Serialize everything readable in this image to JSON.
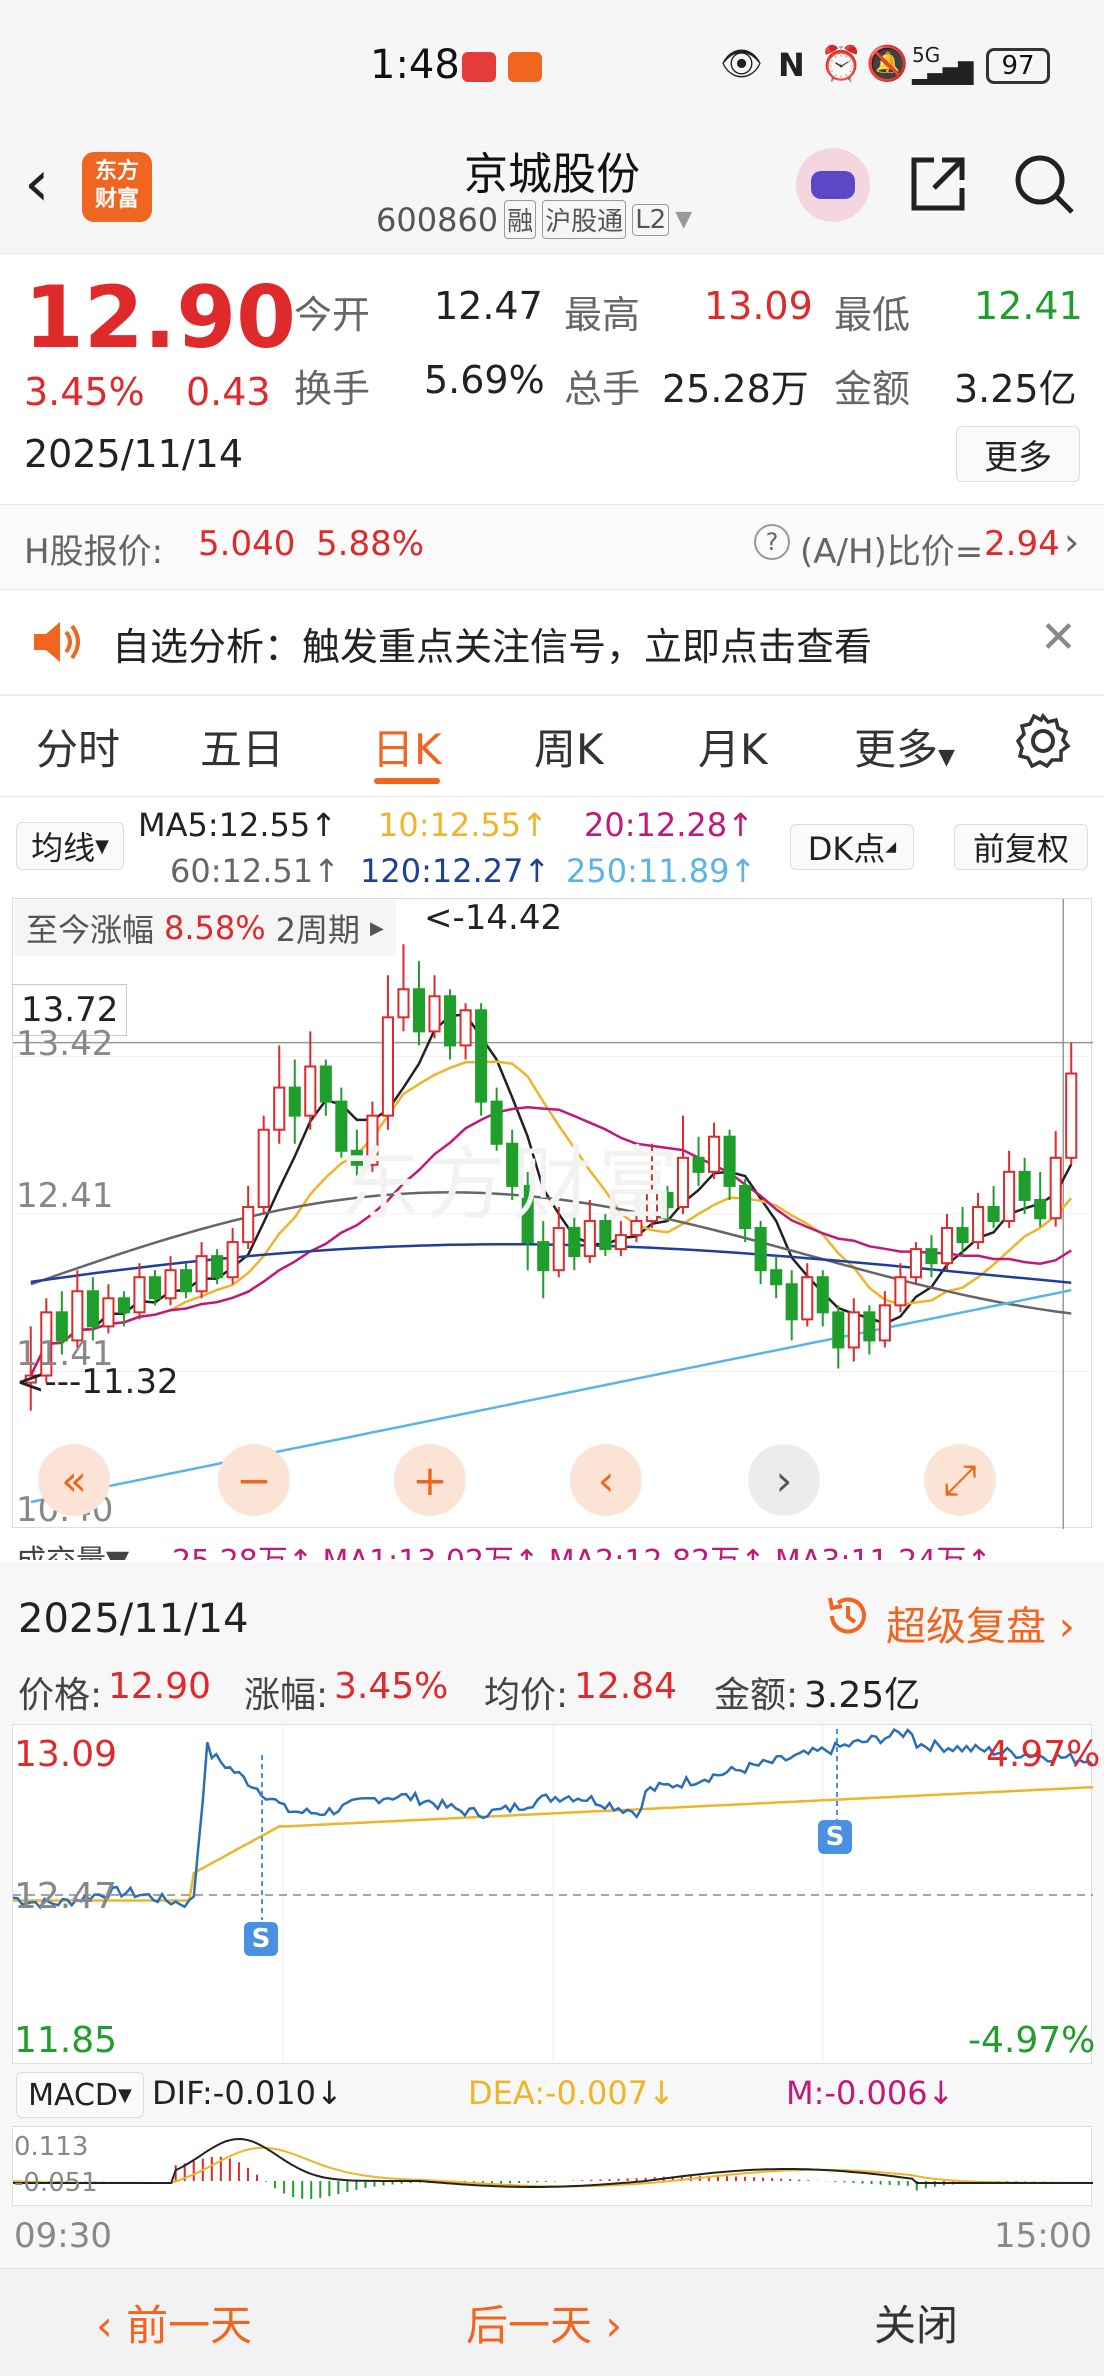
{
  "status_bar": {
    "time": "1:48",
    "battery": "97",
    "network": "5G"
  },
  "header": {
    "logo_text_top": "东方",
    "logo_text_bottom": "财富",
    "stock_name": "京城股份",
    "stock_code": "600860",
    "tags": [
      "融",
      "沪股通",
      "L2"
    ]
  },
  "quote": {
    "price": "12.90",
    "change_pct": "3.45%",
    "change_amt": "0.43",
    "date": "2025/11/14",
    "open_label": "今开",
    "open": "12.47",
    "high_label": "最高",
    "high": "13.09",
    "low_label": "最低",
    "low": "12.41",
    "turnover_label": "换手",
    "turnover": "5.69%",
    "volume_label": "总手",
    "volume": "25.28万",
    "amount_label": "金额",
    "amount": "3.25亿",
    "more_label": "更多"
  },
  "h_share": {
    "label": "H股报价:",
    "price": "5.040",
    "pct": "5.88%",
    "ratio_label": "(A/H)比价=",
    "ratio": "2.94"
  },
  "notice": {
    "text": "自选分析：触发重点关注信号，立即点击查看"
  },
  "tabs": [
    {
      "label": "分时"
    },
    {
      "label": "五日"
    },
    {
      "label": "日K"
    },
    {
      "label": "周K"
    },
    {
      "label": "月K"
    },
    {
      "label": "更多"
    }
  ],
  "kline": {
    "indicator_select": "均线",
    "ma5": "MA5:12.55",
    "ma10": "10:12.55",
    "ma20": "20:12.28",
    "ma60": "60:12.51",
    "ma120": "120:12.27",
    "ma250": "250:11.89",
    "dk_label": "DK点",
    "fq_label": "前复权",
    "range_label": "至今涨幅",
    "range_pct": "8.58%",
    "range_period": "2周期",
    "high_mark": "<-14.42",
    "low_mark": "<---11.32",
    "crosshair_price": "13.72",
    "y_labels": [
      "13.42",
      "12.41",
      "11.41",
      "10.40"
    ],
    "vol_label": "成交量",
    "vol_text": "25.28万↑ MA1:13.02万↑ MA2:12.82万↑ MA3:11.24万↑",
    "colors": {
      "ma5": "#222222",
      "ma10": "#f0b429",
      "ma20": "#c2187a",
      "ma60": "#666666",
      "ma120": "#1f3f9e",
      "ma250": "#5ab4e6"
    }
  },
  "chart_data": {
    "type": "candlestick",
    "ylim": [
      10.4,
      14.6
    ],
    "candles": [
      [
        11.3,
        11.35,
        11.7,
        11.1
      ],
      [
        11.35,
        11.8,
        11.9,
        11.3
      ],
      [
        11.8,
        11.6,
        11.95,
        11.5
      ],
      [
        11.6,
        11.95,
        12.1,
        11.55
      ],
      [
        11.95,
        11.7,
        12.05,
        11.6
      ],
      [
        11.7,
        11.9,
        12.0,
        11.65
      ],
      [
        11.9,
        11.8,
        11.95,
        11.7
      ],
      [
        11.8,
        12.05,
        12.15,
        11.75
      ],
      [
        12.05,
        11.9,
        12.1,
        11.85
      ],
      [
        11.9,
        12.1,
        12.2,
        11.85
      ],
      [
        12.1,
        11.95,
        12.15,
        11.9
      ],
      [
        11.95,
        12.2,
        12.3,
        11.9
      ],
      [
        12.2,
        12.05,
        12.25,
        12.0
      ],
      [
        12.05,
        12.3,
        12.4,
        12.0
      ],
      [
        12.3,
        12.55,
        12.7,
        12.25
      ],
      [
        12.55,
        13.1,
        13.2,
        12.5
      ],
      [
        13.1,
        13.4,
        13.7,
        13.0
      ],
      [
        13.4,
        13.2,
        13.6,
        13.0
      ],
      [
        13.2,
        13.55,
        13.8,
        13.1
      ],
      [
        13.55,
        13.3,
        13.6,
        13.2
      ],
      [
        13.3,
        12.95,
        13.4,
        12.9
      ],
      [
        12.95,
        12.85,
        13.1,
        12.75
      ],
      [
        12.85,
        13.2,
        13.3,
        12.8
      ],
      [
        13.2,
        13.9,
        14.2,
        13.1
      ],
      [
        13.9,
        14.1,
        14.42,
        13.8
      ],
      [
        14.1,
        13.8,
        14.3,
        13.7
      ],
      [
        13.8,
        14.05,
        14.2,
        13.75
      ],
      [
        14.05,
        13.7,
        14.1,
        13.6
      ],
      [
        13.7,
        13.95,
        14.0,
        13.6
      ],
      [
        13.95,
        13.3,
        14.0,
        13.2
      ],
      [
        13.3,
        13.0,
        13.4,
        12.95
      ],
      [
        13.0,
        12.7,
        13.1,
        12.6
      ],
      [
        12.7,
        12.3,
        12.8,
        12.1
      ],
      [
        12.3,
        12.1,
        12.45,
        11.9
      ],
      [
        12.1,
        12.4,
        12.55,
        12.05
      ],
      [
        12.4,
        12.2,
        12.5,
        12.1
      ],
      [
        12.2,
        12.45,
        12.6,
        12.15
      ],
      [
        12.45,
        12.25,
        12.5,
        12.2
      ],
      [
        12.25,
        12.35,
        12.45,
        12.2
      ],
      [
        12.35,
        12.45,
        12.55,
        12.3
      ],
      [
        12.45,
        12.65,
        13.0,
        12.4
      ],
      [
        12.65,
        12.55,
        12.7,
        12.45
      ],
      [
        12.55,
        12.9,
        13.2,
        12.5
      ],
      [
        12.9,
        12.8,
        13.05,
        12.7
      ],
      [
        12.8,
        13.05,
        13.15,
        12.75
      ],
      [
        13.05,
        12.7,
        13.1,
        12.6
      ],
      [
        12.7,
        12.4,
        12.75,
        12.3
      ],
      [
        12.4,
        12.1,
        12.45,
        12.0
      ],
      [
        12.1,
        12.0,
        12.2,
        11.9
      ],
      [
        12.0,
        11.75,
        12.1,
        11.6
      ],
      [
        11.75,
        12.05,
        12.15,
        11.7
      ],
      [
        12.05,
        11.8,
        12.1,
        11.7
      ],
      [
        11.8,
        11.55,
        11.85,
        11.4
      ],
      [
        11.55,
        11.8,
        11.9,
        11.45
      ],
      [
        11.8,
        11.6,
        11.85,
        11.5
      ],
      [
        11.6,
        11.85,
        11.95,
        11.55
      ],
      [
        11.85,
        12.05,
        12.15,
        11.8
      ],
      [
        12.05,
        12.25,
        12.3,
        12.0
      ],
      [
        12.25,
        12.15,
        12.35,
        12.05
      ],
      [
        12.15,
        12.4,
        12.5,
        12.1
      ],
      [
        12.4,
        12.3,
        12.55,
        12.2
      ],
      [
        12.3,
        12.55,
        12.65,
        12.25
      ],
      [
        12.55,
        12.45,
        12.7,
        12.4
      ],
      [
        12.45,
        12.8,
        12.95,
        12.4
      ],
      [
        12.8,
        12.6,
        12.9,
        12.5
      ],
      [
        12.6,
        12.47,
        12.8,
        12.41
      ],
      [
        12.47,
        12.9,
        13.09,
        12.41
      ],
      [
        12.9,
        13.5,
        13.72,
        12.85
      ]
    ]
  },
  "kline_controls": [
    "«",
    "−",
    "+",
    "‹",
    "›",
    "⤢"
  ],
  "intraday": {
    "date": "2025/11/14",
    "replay_label": "超级复盘",
    "price_label": "价格:",
    "price": "12.90",
    "chg_label": "涨幅:",
    "chg": "3.45%",
    "avg_label": "均价:",
    "avg": "12.84",
    "amt_label": "金额:",
    "amt": "3.25亿",
    "y_top": "13.09",
    "y_mid": "12.47",
    "y_bottom": "11.85",
    "pct_top": "4.97%",
    "pct_bottom": "-4.97%",
    "signal": "S",
    "time_start": "09:30",
    "time_end": "15:00"
  },
  "macd": {
    "select": "MACD",
    "dif": "DIF:-0.010",
    "dea": "DEA:-0.007",
    "m": "M:-0.006",
    "y_top": "0.113",
    "y_bottom": "-0.051"
  },
  "footer": {
    "prev": "前一天",
    "next": "后一天",
    "close": "关闭"
  },
  "watermark": "东方财富"
}
